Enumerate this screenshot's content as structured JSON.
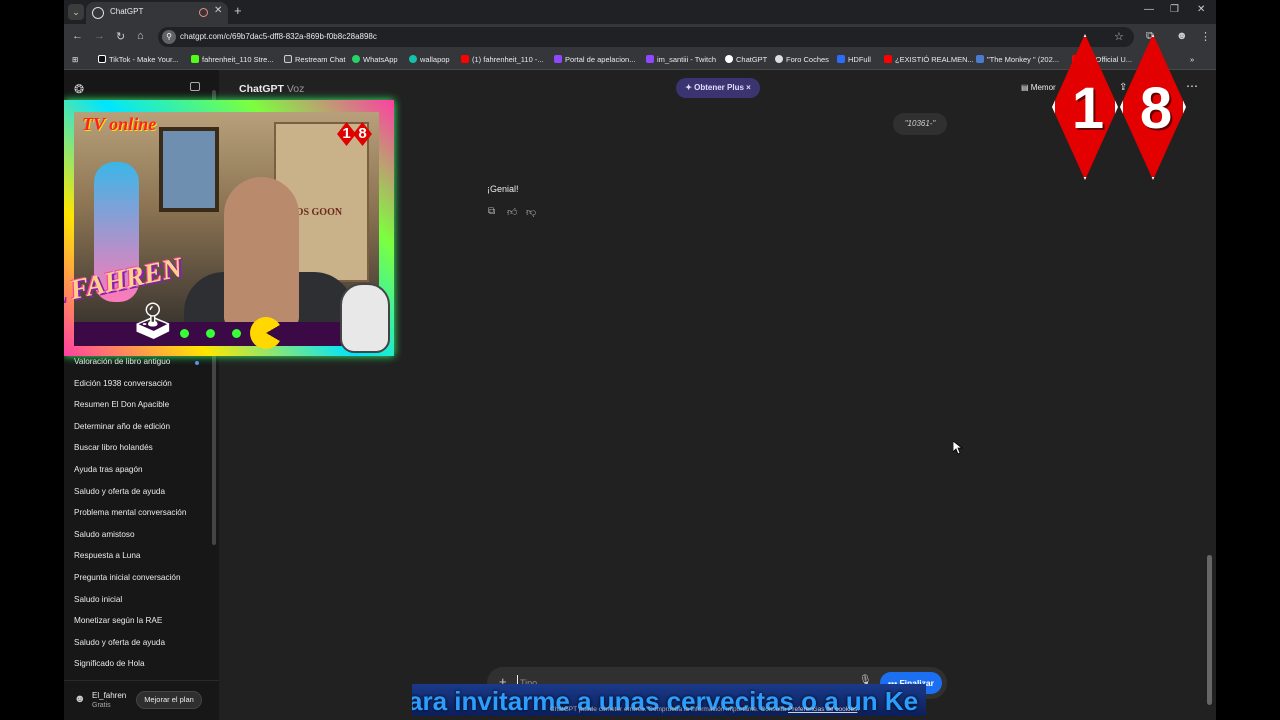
{
  "browser": {
    "tab_title": "ChatGPT",
    "url": "chatgpt.com/c/69b7dac5-dff8-832a-869b-f0b8c28a898c",
    "bookmarks": [
      {
        "label": "TikTok - Make Your...",
        "color": "#111111"
      },
      {
        "label": "fahrenheit_110 Stre...",
        "color": "#53fc18"
      },
      {
        "label": "Restream Chat",
        "color": "#444444"
      },
      {
        "label": "WhatsApp",
        "color": "#25d366"
      },
      {
        "label": "wallapop",
        "color": "#13c1ac"
      },
      {
        "label": "(1) fahrenheit_110 -...",
        "color": "#ff0000"
      },
      {
        "label": "Portal de apelacion...",
        "color": "#9146ff"
      },
      {
        "label": "im_santiii - Twitch",
        "color": "#9146ff"
      },
      {
        "label": "ChatGPT",
        "color": "#ffffff"
      },
      {
        "label": "Foro Coches",
        "color": "#dddddd"
      },
      {
        "label": "HDFull",
        "color": "#2b6cff"
      },
      {
        "label": "¿EXISTIÓ REALMEN...",
        "color": "#ff0000"
      },
      {
        "label": "\"The Monkey \" (202...",
        "color": "#4a7bd0"
      },
      {
        "label": "EN Official U...",
        "color": "#ff0000"
      }
    ]
  },
  "sidebar": {
    "history": [
      "Valoración de libro antiguo",
      "Edición 1938 conversación",
      "Resumen El Don Apacible",
      "Determinar año de edición",
      "Buscar libro holandés",
      "Ayuda tras apagón",
      "Saludo y oferta de ayuda",
      "Problema mental conversación",
      "Saludo amistoso",
      "Respuesta a Luna",
      "Pregunta inicial conversación",
      "Saludo inicial",
      "Monetizar según la RAE",
      "Saludo y oferta de ayuda",
      "Significado de Hola"
    ],
    "user_name": "El_fahren",
    "user_plan": "Gratis",
    "upgrade_label": "Mejorar el plan"
  },
  "header": {
    "title": "ChatGPT",
    "title_suffix": "Voz",
    "get_plus_label": "✦ Obtener Plus ×",
    "memory_label": "Memor"
  },
  "messages": {
    "user_text": "\"10361-\"",
    "assistant_text": "¡Genial!"
  },
  "composer": {
    "placeholder": "Tipo",
    "finish_label": "Finalizar",
    "disclaimer_prefix": "ChatGPT puede cometer errores. Comprueba la información importante. Consulta ",
    "disclaimer_link": "Preferencias de cookies",
    "disclaimer_suffix": "."
  },
  "overlay": {
    "tv_online": "TV online",
    "mini_rating": [
      "1",
      "8"
    ],
    "poster_text": "LOS GOON",
    "brand": "EL FAHREN",
    "rating": [
      "1",
      "8"
    ],
    "subtitle": "ara invitarme a unas cervecitas o a un Ke"
  },
  "colors": {
    "accent_blue": "#1d6ff2",
    "plus_bg": "#3a3570",
    "rating_red": "#e30000"
  }
}
